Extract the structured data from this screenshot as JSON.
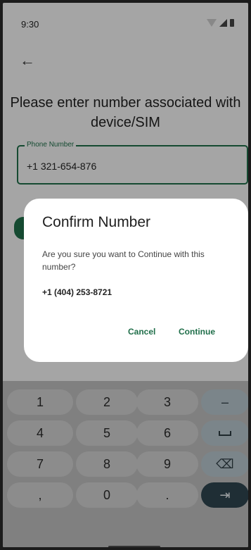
{
  "status_bar": {
    "time": "9:30"
  },
  "screen": {
    "title": "Please enter number associated with device/SIM",
    "phone_field": {
      "label": "Phone Number",
      "value": "+1 321-654-876"
    }
  },
  "dialog": {
    "title": "Confirm Number",
    "body": "Are you sure you want to Continue with this number?",
    "number": "+1 (404) 253-8721",
    "cancel_label": "Cancel",
    "continue_label": "Continue"
  },
  "keyboard": {
    "rows": [
      [
        "1",
        "2",
        "3",
        "–"
      ],
      [
        "4",
        "5",
        "6",
        ""
      ],
      [
        "7",
        "8",
        "9",
        "⌫"
      ],
      [
        ",",
        "0",
        ".",
        "⇥"
      ]
    ]
  },
  "colors": {
    "accent": "#1f6e49",
    "enter_key": "#2e444f"
  }
}
